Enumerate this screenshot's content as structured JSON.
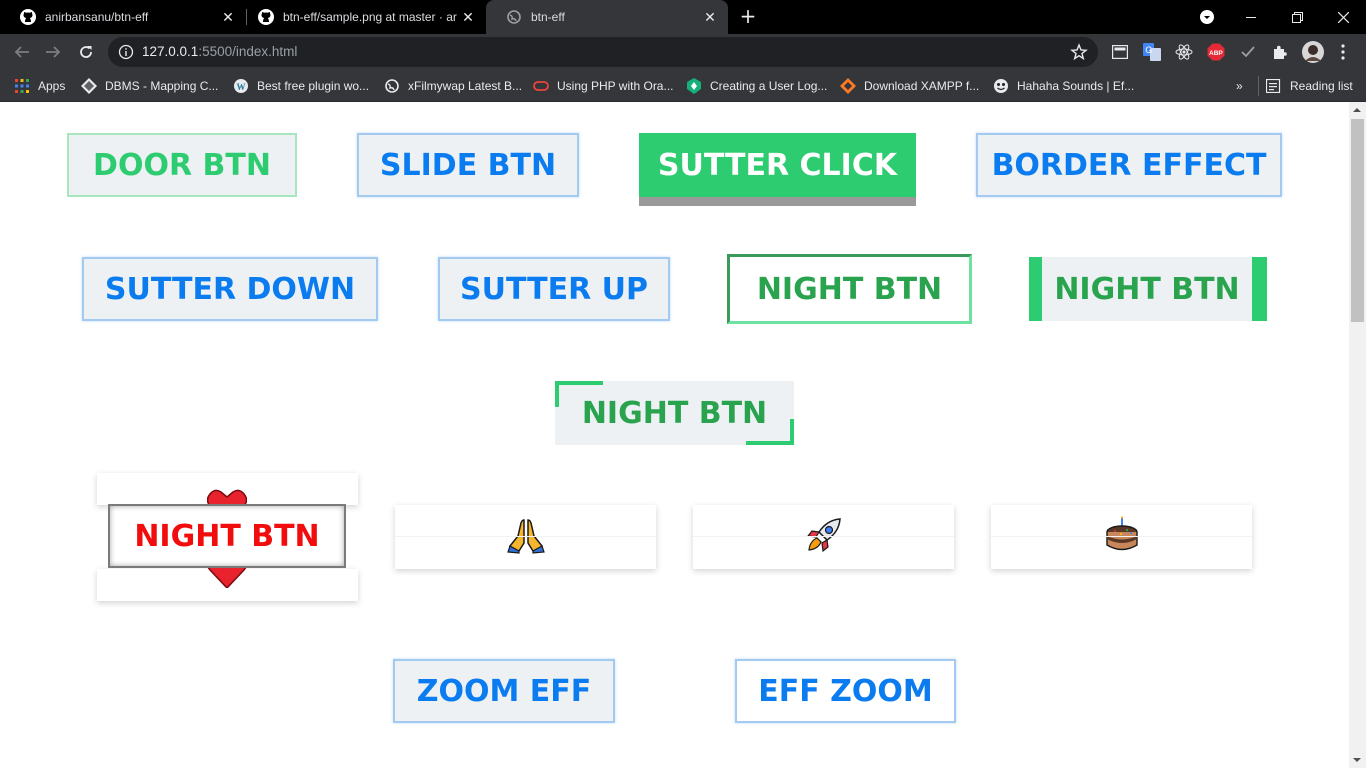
{
  "browser": {
    "tabs": [
      {
        "title": "anirbansanu/btn-eff",
        "icon": "github-icon",
        "active": false
      },
      {
        "title": "btn-eff/sample.png at master · ar",
        "icon": "github-icon",
        "active": false
      },
      {
        "title": "btn-eff",
        "icon": "globe-icon",
        "active": true
      }
    ],
    "url_host": "127.0.0.1",
    "url_rest": ":5500/index.html",
    "bookmarks": [
      {
        "label": "Apps",
        "icon": "apps-grid-icon"
      },
      {
        "label": "DBMS - Mapping C...",
        "icon": "dbms-icon"
      },
      {
        "label": "Best free plugin wo...",
        "icon": "wordpress-icon"
      },
      {
        "label": "xFilmywap Latest B...",
        "icon": "globe-icon"
      },
      {
        "label": "Using PHP with Ora...",
        "icon": "oracle-icon"
      },
      {
        "label": "Creating a User Log...",
        "icon": "shield-icon"
      },
      {
        "label": "Download XAMPP f...",
        "icon": "xampp-icon"
      },
      {
        "label": "Hahaha Sounds | Ef...",
        "icon": "sounds-icon"
      }
    ],
    "overflow": "»",
    "reading_list": "Reading list",
    "extensions": {
      "abp_label": "ABP"
    }
  },
  "page": {
    "row1": [
      "DOOR BTN",
      "SLIDE BTN",
      "SUTTER CLICK",
      "BORDER EFFECT"
    ],
    "row2": [
      "SUTTER DOWN",
      "SUTTER UP",
      "NIGHT BTN",
      "NIGHT BTN"
    ],
    "center_btn": "NIGHT BTN",
    "heart_btn": "NIGHT BTN",
    "emoji_btns": [
      "🙏",
      "🚀",
      "🎂"
    ],
    "heart_emoji": "❤️",
    "zoom_btns": [
      "ZOOM EFF",
      "EFF ZOOM"
    ]
  },
  "colors": {
    "blue_text": "#0a7cf0",
    "green": "#2ecc71",
    "dark_green_text": "#2aa34f",
    "red_text": "#f10d0d",
    "button_bg": "#edf1f4"
  }
}
